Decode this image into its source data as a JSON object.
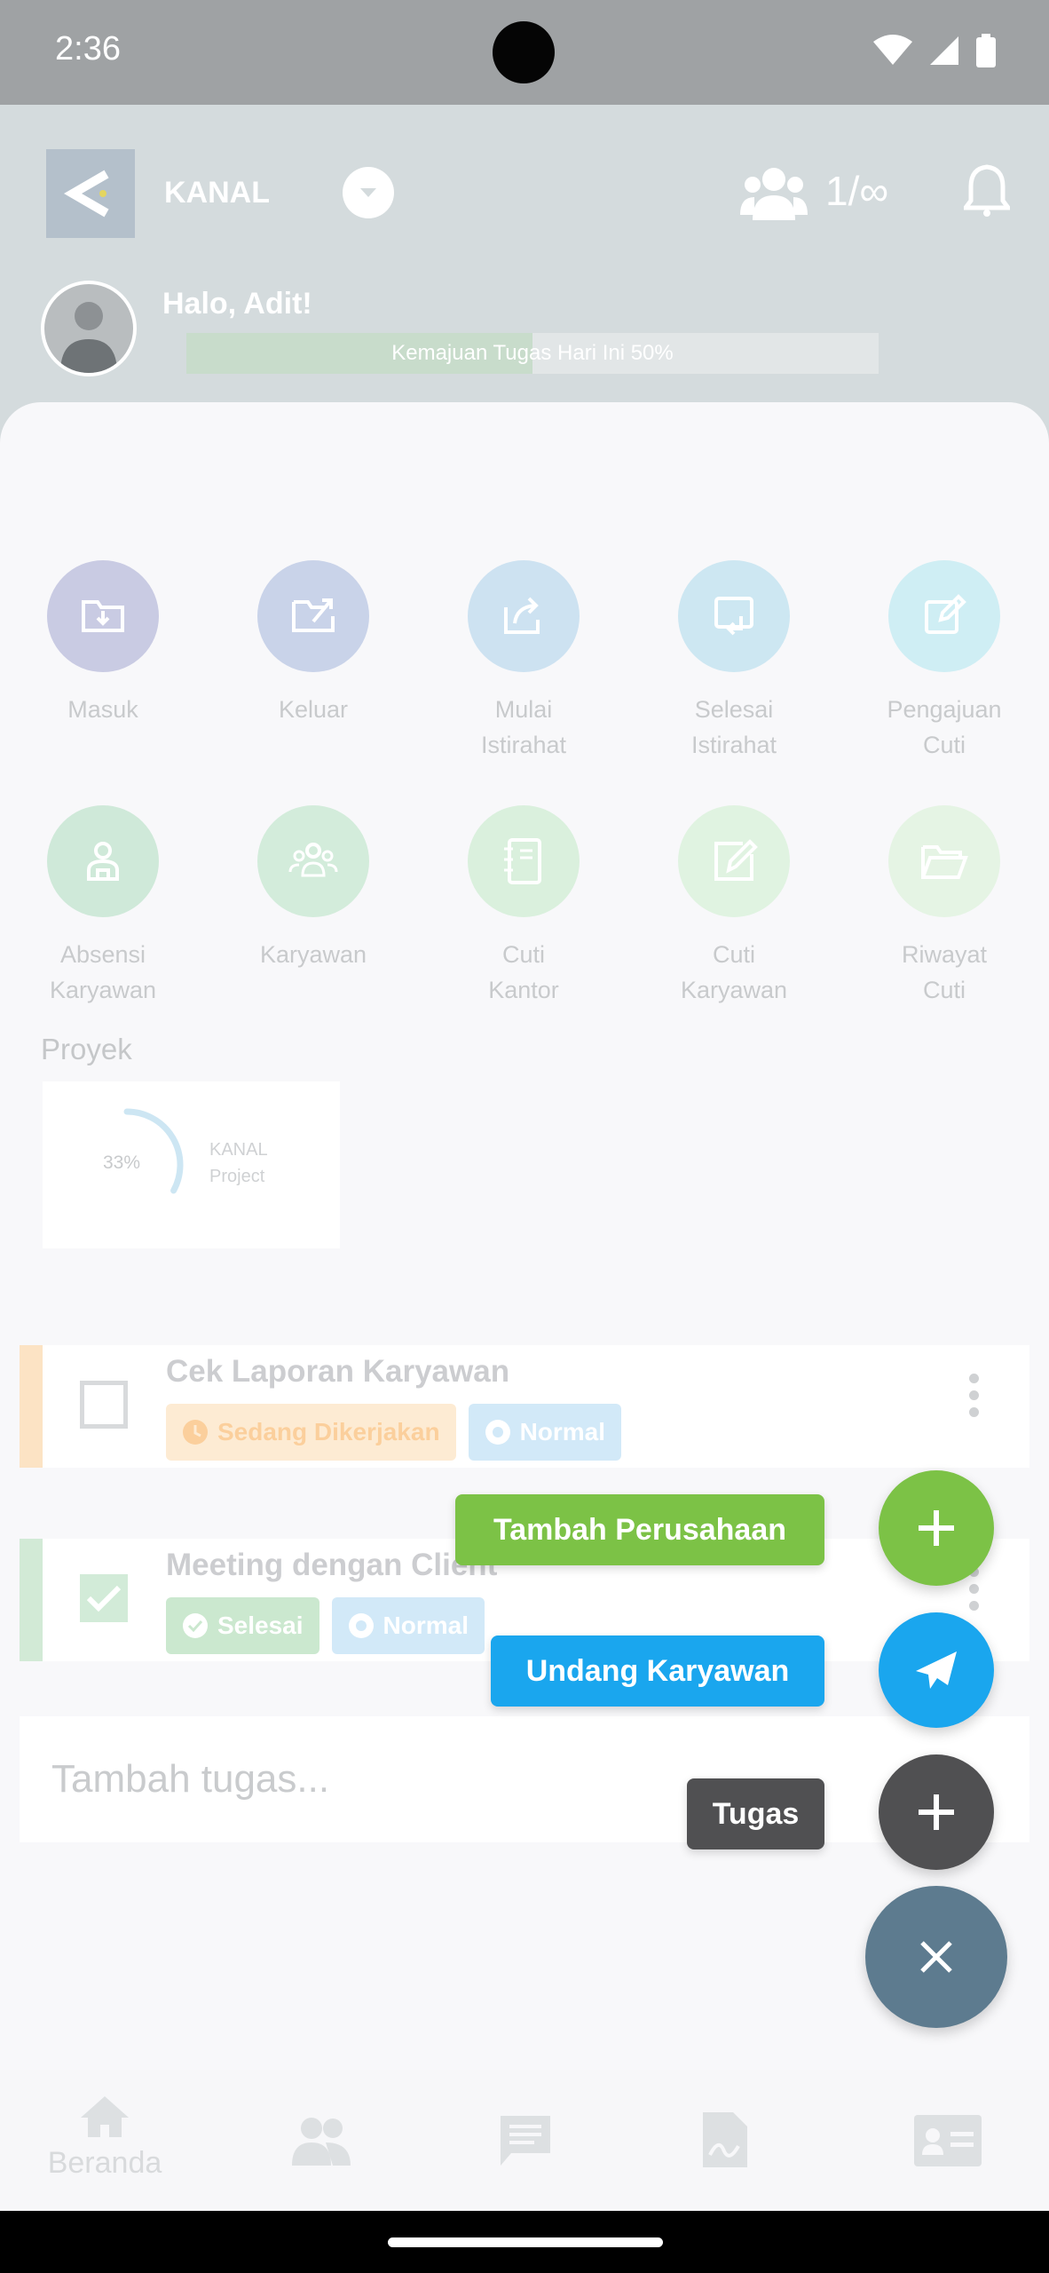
{
  "status_bar": {
    "time": "2:36"
  },
  "header": {
    "brand": "KANAL",
    "team_count": "1/∞",
    "greeting": "Halo, Adit!",
    "progress_text": "Kemajuan Tugas Hari Ini 50%",
    "progress_value": 0.5
  },
  "menu": [
    {
      "label": "Masuk",
      "icon": "folder-in-icon",
      "color": "#c9cbe3"
    },
    {
      "label": "Keluar",
      "icon": "folder-out-icon",
      "color": "#c9d3e9"
    },
    {
      "label": "Mulai\nIstirahat",
      "icon": "share-icon",
      "color": "#cde2f1"
    },
    {
      "label": "Selesai\nIstirahat",
      "icon": "return-icon",
      "color": "#cde7f2"
    },
    {
      "label": "Pengajuan\nCuti",
      "icon": "edit-icon",
      "color": "#cfeef4"
    },
    {
      "label": "Absensi\nKaryawan",
      "icon": "person-icon",
      "color": "#cfe9d9"
    },
    {
      "label": "Karyawan",
      "icon": "group-icon",
      "color": "#d3ecdb"
    },
    {
      "label": "Cuti\nKantor",
      "icon": "notebook-icon",
      "color": "#daf0dd"
    },
    {
      "label": "Cuti\nKaryawan",
      "icon": "pencil-square-icon",
      "color": "#e0f3e1"
    },
    {
      "label": "Riwayat\nCuti",
      "icon": "folder-open-icon",
      "color": "#e5f4e4"
    }
  ],
  "projects": {
    "title": "Proyek",
    "items": [
      {
        "percent": "33%",
        "progress": 0.33,
        "name": "KANAL Project"
      }
    ]
  },
  "tasks": [
    {
      "title": "Cek Laporan Karyawan",
      "status": "Sedang Dikerjakan",
      "priority": "Normal",
      "done": false,
      "strip_color": "#fce3c4"
    },
    {
      "title": "Meeting dengan Client",
      "status": "Selesai",
      "priority": "Normal",
      "done": true,
      "strip_color": "#d2ead6"
    }
  ],
  "add_task": {
    "placeholder": "Tambah tugas..."
  },
  "speed_dial": {
    "items": [
      {
        "label": "Tambah Perusahaan",
        "color": "#7cc246",
        "icon": "plus-icon"
      },
      {
        "label": "Undang Karyawan",
        "color": "#1aa6ee",
        "icon": "send-icon"
      },
      {
        "label": "Tugas",
        "color": "#505052",
        "icon": "plus-icon"
      }
    ],
    "close_color": "#5d7b8f"
  },
  "bottom_nav": [
    {
      "label": "Beranda",
      "icon": "home-icon"
    },
    {
      "label": "",
      "icon": "people-icon"
    },
    {
      "label": "",
      "icon": "chat-icon"
    },
    {
      "label": "",
      "icon": "document-icon"
    },
    {
      "label": "",
      "icon": "id-card-icon"
    }
  ]
}
